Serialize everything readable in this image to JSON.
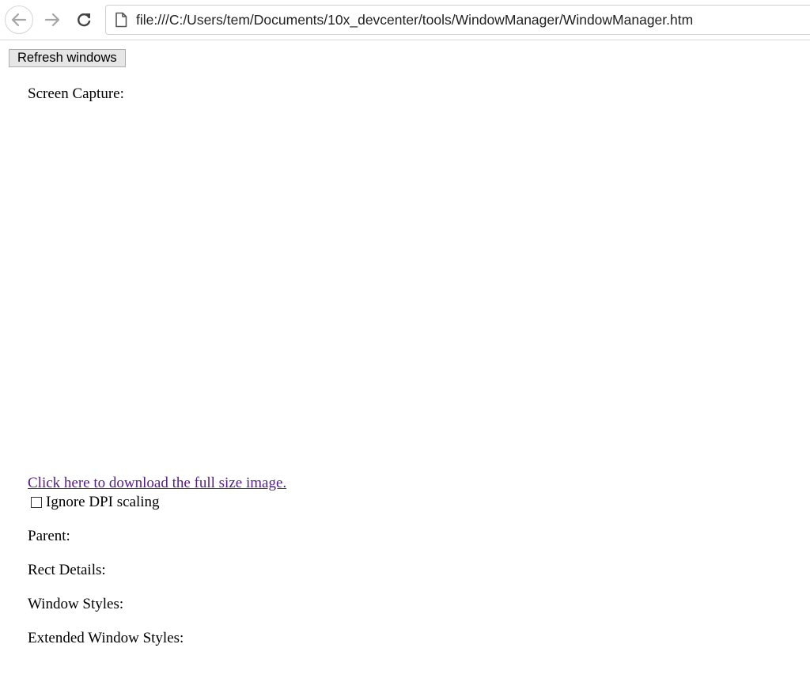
{
  "browser": {
    "url": "file:///C:/Users/tem/Documents/10x_devcenter/tools/WindowManager/WindowManager.htm",
    "icons": {
      "back": "back-arrow-icon",
      "forward": "forward-arrow-icon",
      "reload": "reload-icon",
      "page": "page-icon"
    }
  },
  "page": {
    "refresh_button_label": "Refresh windows",
    "screen_capture_label": "Screen Capture:",
    "download_link_text": "Click here to download the full size image.",
    "ignore_dpi": {
      "label": "Ignore DPI scaling",
      "checked": false
    },
    "parent_label": "Parent:",
    "rect_details_label": "Rect Details:",
    "window_styles_label": "Window Styles:",
    "extended_window_styles_label": "Extended Window Styles:"
  },
  "colors": {
    "visited_link": "#551a8b",
    "nav_icon": "#9a9a9a",
    "reload_icon": "#444444"
  }
}
